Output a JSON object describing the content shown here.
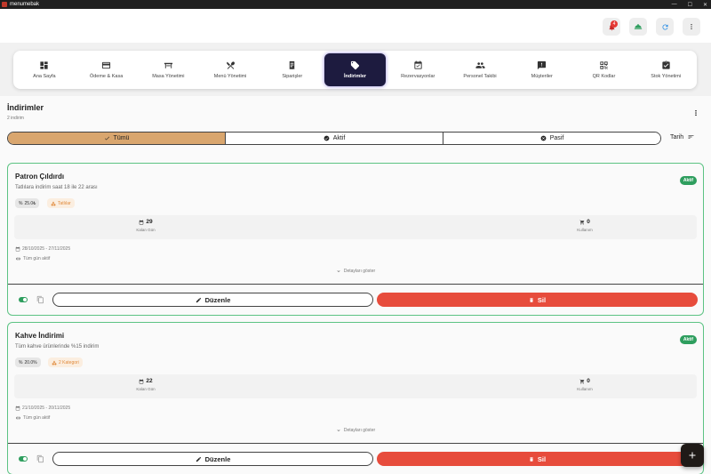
{
  "window": {
    "title": "menumebak",
    "controls": [
      "—",
      "☐",
      "✕"
    ]
  },
  "topbar": {
    "notifications_count": "4",
    "icons": [
      "bell-icon",
      "dome-icon",
      "refresh-icon",
      "more-icon"
    ]
  },
  "nav": {
    "items": [
      {
        "label": "Ana Sayfa",
        "icon": "dashboard-icon"
      },
      {
        "label": "Ödeme & Kasa",
        "icon": "wallet-icon"
      },
      {
        "label": "Masa Yönetimi",
        "icon": "table-icon"
      },
      {
        "label": "Menü Yönetimi",
        "icon": "cutlery-icon"
      },
      {
        "label": "Siparişler",
        "icon": "receipt-icon"
      },
      {
        "label": "İndirimler",
        "icon": "tag-icon",
        "active": true
      },
      {
        "label": "Rezervasyonlar",
        "icon": "calendar-check-icon"
      },
      {
        "label": "Personel Takibi",
        "icon": "people-icon"
      },
      {
        "label": "Müşteriler",
        "icon": "feedback-icon"
      },
      {
        "label": "QR Kodlar",
        "icon": "qr-icon"
      },
      {
        "label": "Stok Yönetimi",
        "icon": "inventory-icon"
      }
    ]
  },
  "header": {
    "title": "İndirimler",
    "subtitle": "2 indirim"
  },
  "filter": {
    "options": [
      "Tümü",
      "Aktif",
      "Pasif"
    ],
    "selected": "Tümü"
  },
  "sort": {
    "label": "Tarih"
  },
  "discounts": [
    {
      "title": "Patron Çıldırdı",
      "description": "Tatlılara indirim saat 18 ile 22 arası",
      "status": "Aktif",
      "percent": "25.0₺",
      "category": "Tatlılar",
      "remaining_days": "29",
      "remaining_label": "Kalan Gün",
      "usage": "0",
      "usage_label": "Kullanım",
      "date_range": "28/10/2025 - 27/11/2025",
      "all_day": "Tüm gün aktif",
      "details": "Detayları göster",
      "edit_label": "Düzenle",
      "delete_label": "Sil"
    },
    {
      "title": "Kahve İndirimi",
      "description": "Tüm kahve ürünlerinde %15 indirim",
      "status": "Aktif",
      "percent": "20.0%",
      "category": "2 Kategori",
      "remaining_days": "22",
      "remaining_label": "Kalan Gün",
      "usage": "0",
      "usage_label": "Kullanım",
      "date_range": "21/10/2025 - 20/11/2025",
      "all_day": "Tüm gün aktif",
      "details": "Detayları göster",
      "edit_label": "Düzenle",
      "delete_label": "Sil"
    }
  ],
  "colors": {
    "accent": "#d9a66e",
    "active_nav": "#1d1b3f",
    "success": "#2e9e5e",
    "danger": "#e74c3c"
  }
}
